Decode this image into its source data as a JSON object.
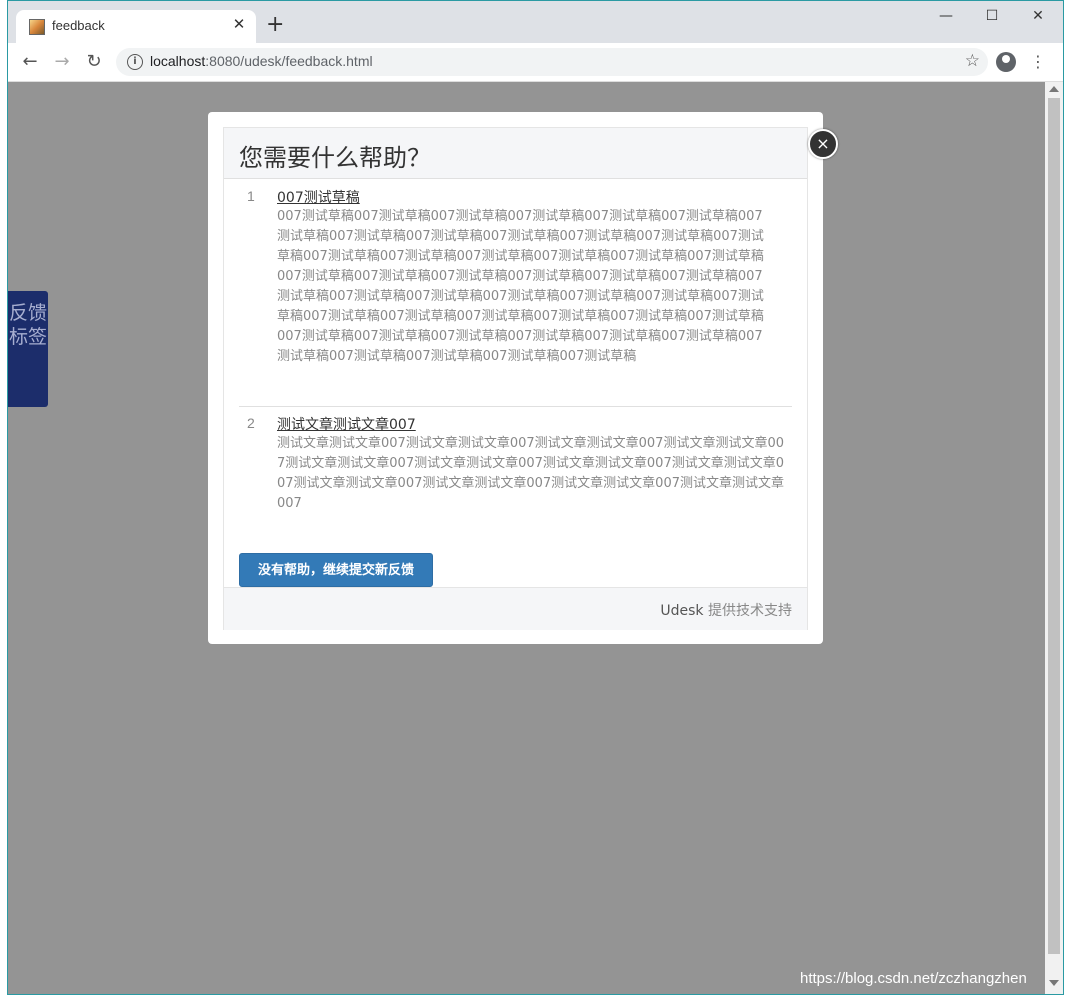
{
  "browser": {
    "tab_title": "feedback",
    "tab_close": "✕",
    "new_tab": "+",
    "url_host": "localhost",
    "url_path": ":8080/udesk/feedback.html",
    "controls": {
      "minimize": "—",
      "maximize": "☐",
      "close": "✕"
    }
  },
  "page": {
    "feedback_tab_label": "反馈标签",
    "watermark": "https://blog.csdn.net/zczhangzhen"
  },
  "modal": {
    "close_label": "×",
    "title": "您需要什么帮助？",
    "articles": [
      {
        "num": "1",
        "title": "007测试草稿",
        "body": "007测试草稿007测试草稿007测试草稿007测试草稿007测试草稿007测试草稿007测试草稿007测试草稿007测试草稿007测试草稿007测试草稿007测试草稿007测试草稿007测试草稿007测试草稿007测试草稿007测试草稿007测试草稿007测试草稿007测试草稿007测试草稿007测试草稿007测试草稿007测试草稿007测试草稿007测试草稿007测试草稿007测试草稿007测试草稿007测试草稿007测试草稿007测试草稿007测试草稿007测试草稿007测试草稿007测试草稿007测试草稿007测试草稿007测试草稿007测试草稿007测试草稿007测试草稿007测试草稿007测试草稿007测试草稿007测试草稿007测试草稿007测试草稿007测试草稿"
      },
      {
        "num": "2",
        "title": "测试文章测试文章007",
        "body": "测试文章测试文章007测试文章测试文章007测试文章测试文章007测试文章测试文章007测试文章测试文章007测试文章测试文章007测试文章测试文章007测试文章测试文章007测试文章测试文章007测试文章测试文章007测试文章测试文章007测试文章测试文章007"
      }
    ],
    "submit_label": "没有帮助，继续提交新反馈",
    "footer_brand": "Udesk",
    "footer_text": "提供技术支持"
  }
}
